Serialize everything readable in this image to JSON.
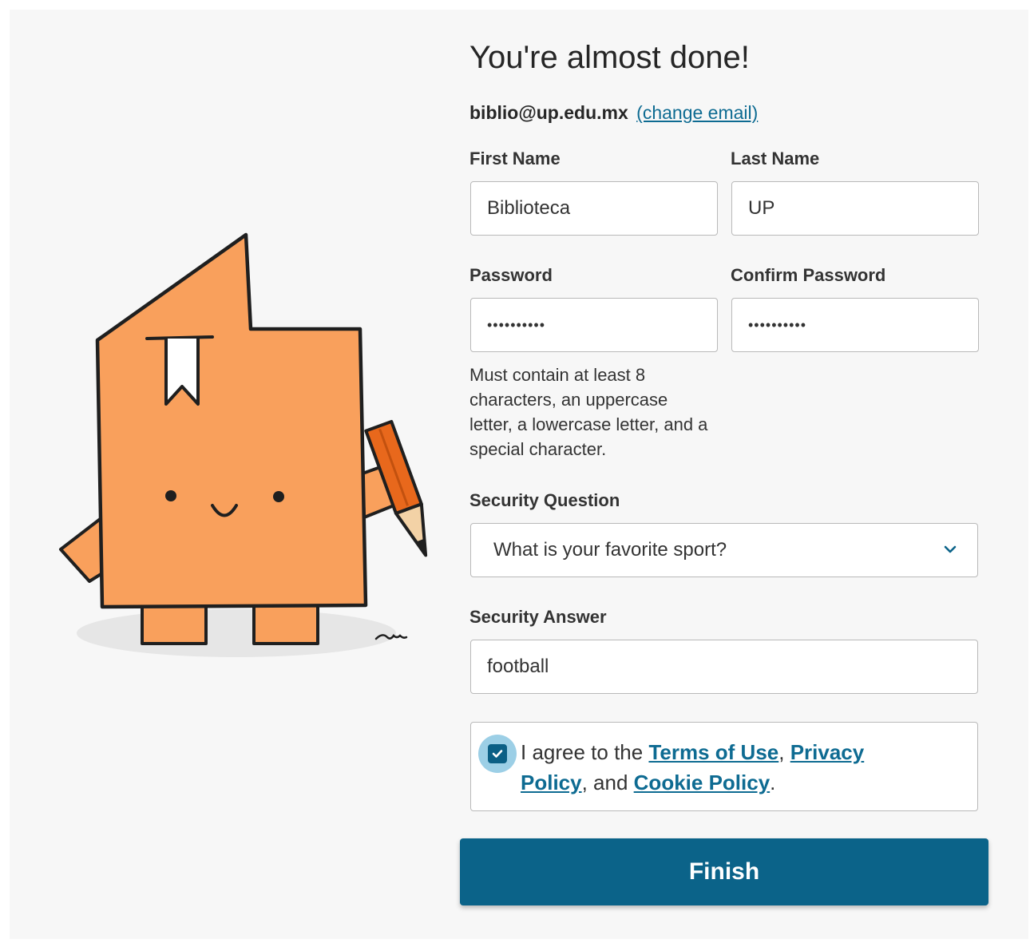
{
  "page": {
    "title": "You're almost done!",
    "email": "biblio@up.edu.mx",
    "change_email_link": "(change email)"
  },
  "form": {
    "first_name": {
      "label": "First Name",
      "value": "Biblioteca"
    },
    "last_name": {
      "label": "Last Name",
      "value": "UP"
    },
    "password": {
      "label": "Password",
      "value": "••••••••••"
    },
    "confirm_password": {
      "label": "Confirm Password",
      "value": "••••••••••"
    },
    "password_hint": "Must contain at least 8 characters, an uppercase letter, a lowercase letter, and a special character.",
    "security_question": {
      "label": "Security Question",
      "selected": "What is your favorite sport?"
    },
    "security_answer": {
      "label": "Security Answer",
      "value": "football"
    }
  },
  "terms": {
    "checked": true,
    "prefix": "I agree to the ",
    "terms_link": "Terms of Use",
    "comma": ", ",
    "privacy_link": "Privacy Policy",
    "and": ", and ",
    "cookie_link": "Cookie Policy",
    "period": "."
  },
  "finish_button": "Finish",
  "colors": {
    "accent": "#0b6389",
    "link": "#0e6b92",
    "mascot_orange": "#f9a05c",
    "pencil_orange": "#e8681c",
    "background": "#f7f7f7"
  },
  "icons": {
    "dropdown": "chevron-down-icon",
    "checkbox": "check-icon"
  }
}
